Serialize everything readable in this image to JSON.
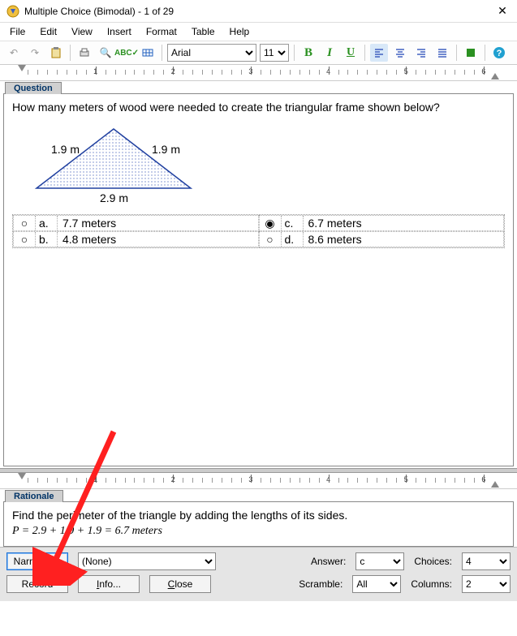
{
  "window": {
    "title": "Multiple Choice (Bimodal) - 1 of 29"
  },
  "menu": {
    "file": "File",
    "edit": "Edit",
    "view": "View",
    "insert": "Insert",
    "format": "Format",
    "table": "Table",
    "help": "Help"
  },
  "toolbar": {
    "font": "Arial",
    "size": "11"
  },
  "ruler": {
    "marks": [
      "1",
      "2",
      "3",
      "4",
      "5",
      "6"
    ]
  },
  "sections": {
    "question_tab": "Question",
    "rationale_tab": "Rationale"
  },
  "question": {
    "text": "How many meters of wood were needed to create the triangular frame shown below?",
    "triangle": {
      "left": "1.9 m",
      "right": "1.9 m",
      "base": "2.9 m"
    },
    "choices": {
      "a": {
        "label": "a.",
        "text": "7.7 meters",
        "selected": false
      },
      "b": {
        "label": "b.",
        "text": "4.8 meters",
        "selected": false
      },
      "c": {
        "label": "c.",
        "text": "6.7 meters",
        "selected": true
      },
      "d": {
        "label": "d.",
        "text": "8.6 meters",
        "selected": false
      }
    }
  },
  "rationale": {
    "line1": "Find the perimeter of the triangle by adding the lengths of its sides.",
    "equation": "P = 2.9 + 1.9 + 1.9 = 6.7 meters"
  },
  "bottom": {
    "narrative_btn": "Narrative...",
    "narrative_sel": "(None)",
    "record_btn": "Record",
    "info_btn": "Info...",
    "close_btn": "Close",
    "answer_label": "Answer:",
    "answer_val": "c",
    "choices_label": "Choices:",
    "choices_val": "4",
    "scramble_label": "Scramble:",
    "scramble_val": "All",
    "columns_label": "Columns:",
    "columns_val": "2"
  }
}
